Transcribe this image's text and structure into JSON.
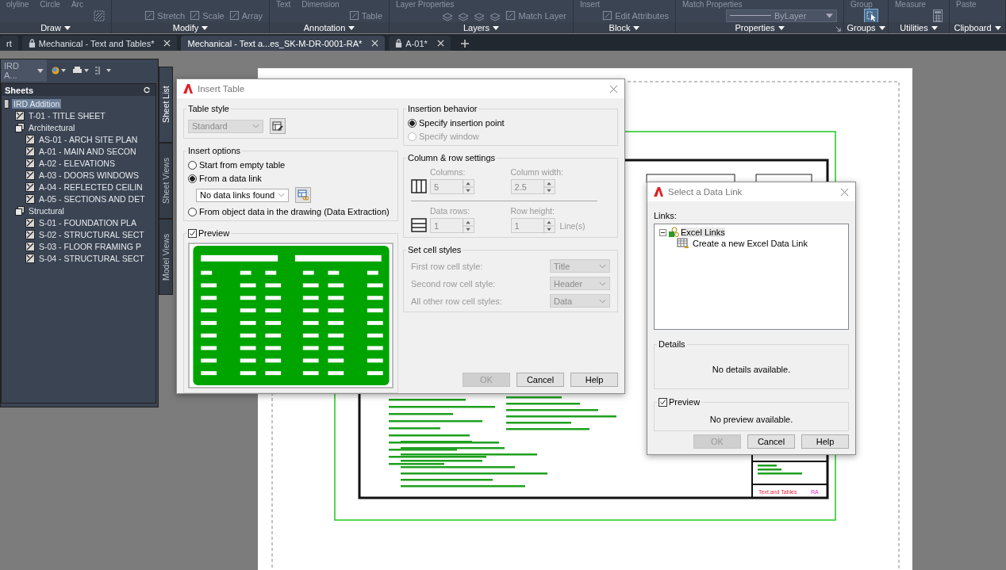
{
  "ribbon": {
    "panels": [
      {
        "title": "Draw",
        "upper": [
          "olyline",
          "Circle",
          "Arc"
        ]
      },
      {
        "title": "Modify",
        "tools": [
          "Stretch",
          "Scale",
          "Array"
        ]
      },
      {
        "title": "Annotation",
        "upper": [
          "Text",
          "Dimension"
        ],
        "tools": [
          "Table"
        ]
      },
      {
        "title": "Layers",
        "upper": [
          "Layer Properties"
        ],
        "tools": [
          "Match Layer"
        ]
      },
      {
        "title": "Block",
        "upper": [
          "Insert"
        ],
        "tools": [
          "Edit Attributes"
        ]
      },
      {
        "title": "Properties",
        "upper": [
          "Match Properties"
        ],
        "dropdown": "ByLayer"
      },
      {
        "title": "Groups",
        "upper": [
          "Group"
        ]
      },
      {
        "title": "Utilities",
        "upper": [
          "Measure"
        ]
      },
      {
        "title": "Clipboard",
        "upper": [
          "Paste"
        ]
      }
    ]
  },
  "document_tabs": [
    {
      "label": "rt",
      "locked": false,
      "selected": false,
      "closable": false
    },
    {
      "label": "Mechanical - Text and Tables*",
      "locked": true,
      "selected": false,
      "closable": true
    },
    {
      "label": "Mechanical - Text a...es_SK-M-DR-0001-RA*",
      "locked": false,
      "selected": true,
      "closable": true
    },
    {
      "label": "A-01*",
      "locked": true,
      "selected": false,
      "closable": true
    }
  ],
  "sheet_set_manager": {
    "dropdown": "IRD A...",
    "header": "Sheets",
    "tree": [
      {
        "label": "IRD Addition",
        "kind": "set",
        "selected": true,
        "children": [
          {
            "label": "T-01 - TITLE SHEET",
            "kind": "sheet",
            "selected": false
          },
          {
            "label": "Architectural",
            "kind": "subset",
            "selected": false,
            "children": [
              {
                "label": "AS-01 - ARCH SITE PLAN",
                "kind": "sheet",
                "selected": false
              },
              {
                "label": "A-01 - MAIN AND SECON",
                "kind": "sheet",
                "selected": false
              },
              {
                "label": "A-02 - ELEVATIONS",
                "kind": "sheet",
                "selected": false
              },
              {
                "label": "A-03 - DOORS WINDOWS",
                "kind": "sheet",
                "selected": false
              },
              {
                "label": "A-04 - REFLECTED CEILIN",
                "kind": "sheet",
                "selected": false
              },
              {
                "label": "A-05 - SECTIONS AND DET",
                "kind": "sheet",
                "selected": false
              }
            ]
          },
          {
            "label": "Structural",
            "kind": "subset",
            "selected": false,
            "children": [
              {
                "label": "S-01 - FOUNDATION PLA",
                "kind": "sheet",
                "selected": false
              },
              {
                "label": "S-02 - STRUCTURAL SECT",
                "kind": "sheet",
                "selected": false
              },
              {
                "label": "S-03 - FLOOR FRAMING P",
                "kind": "sheet",
                "selected": false
              },
              {
                "label": "S-04 - STRUCTURAL SECT",
                "kind": "sheet",
                "selected": false
              }
            ]
          }
        ]
      }
    ],
    "side_tabs": [
      {
        "label": "Sheet List",
        "selected": true
      },
      {
        "label": "Sheet Views",
        "selected": false
      },
      {
        "label": "Model Views",
        "selected": false
      }
    ]
  },
  "drawing": {
    "title": "Text and Tables",
    "revision": "RA"
  },
  "insert_table": {
    "title": "Insert Table",
    "table_style": {
      "label": "Table style",
      "value": "Standard",
      "disabled": true
    },
    "insert_options": {
      "label": "Insert options",
      "options": [
        {
          "label": "Start from empty table",
          "selected": false
        },
        {
          "label": "From a data link",
          "selected": true
        },
        {
          "label": "From object data in the drawing (Data Extraction)",
          "selected": false
        }
      ],
      "data_link": "No data links found"
    },
    "preview": {
      "label": "Preview",
      "checked": true
    },
    "insertion_behavior": {
      "label": "Insertion behavior",
      "options": [
        {
          "label": "Specify insertion point",
          "selected": true,
          "disabled": false
        },
        {
          "label": "Specify window",
          "selected": false,
          "disabled": true
        }
      ]
    },
    "column_row_settings": {
      "label": "Column & row settings",
      "fields": [
        {
          "label": "Columns:",
          "value": "5",
          "disabled": true
        },
        {
          "label": "Column width:",
          "value": "2.5",
          "disabled": true
        },
        {
          "label": "Data rows:",
          "value": "1",
          "disabled": true
        },
        {
          "label": "Row height:",
          "value": "1",
          "unit": "Line(s)",
          "disabled": true
        }
      ]
    },
    "cell_styles": {
      "label": "Set cell styles",
      "rows": [
        {
          "label": "First row cell style:",
          "value": "Title",
          "disabled": true
        },
        {
          "label": "Second row cell style:",
          "value": "Header",
          "disabled": true
        },
        {
          "label": "All other row cell styles:",
          "value": "Data",
          "disabled": true
        }
      ]
    },
    "buttons": [
      {
        "label": "OK",
        "disabled": true
      },
      {
        "label": "Cancel",
        "disabled": false
      },
      {
        "label": "Help",
        "disabled": false
      }
    ]
  },
  "select_data_link": {
    "title": "Select a Data Link",
    "links_label": "Links:",
    "links": [
      {
        "label": "Excel Links",
        "expanded": true,
        "children": [
          {
            "label": "Create a new Excel Data Link"
          }
        ]
      }
    ],
    "details": {
      "label": "Details",
      "text": "No details available."
    },
    "preview": {
      "label": "Preview",
      "checked": true,
      "text": "No preview available."
    },
    "buttons": [
      {
        "label": "OK",
        "disabled": true
      },
      {
        "label": "Cancel",
        "disabled": false
      },
      {
        "label": "Help",
        "disabled": false
      }
    ]
  }
}
